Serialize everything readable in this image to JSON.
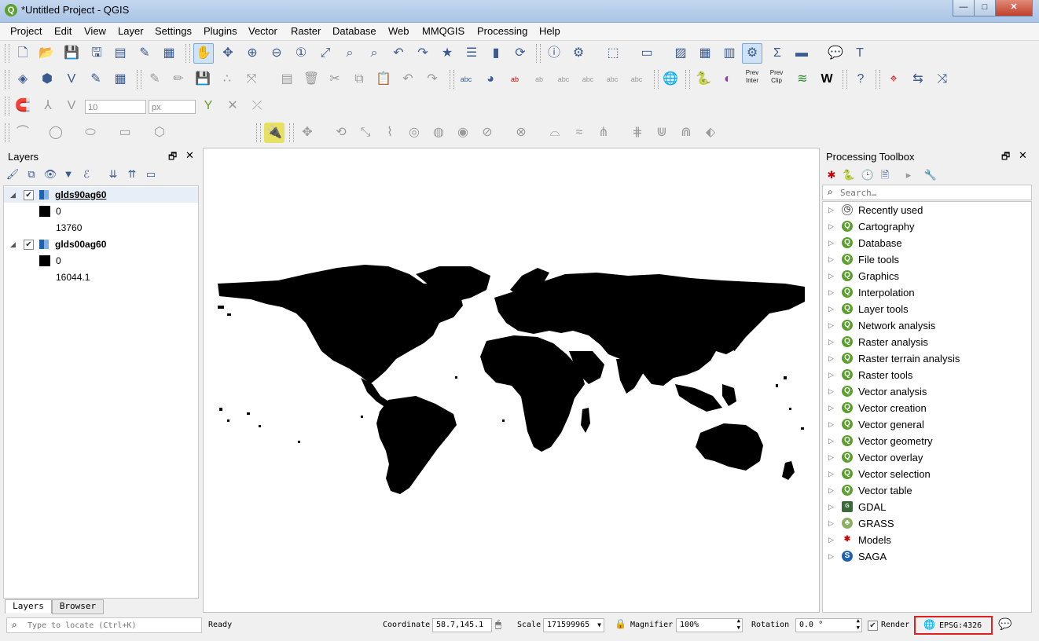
{
  "window": {
    "title": "*Untitled Project - QGIS",
    "min": "—",
    "max": "□",
    "close": "✕"
  },
  "menu": [
    "Project",
    "Edit",
    "View",
    "Layer",
    "Settings",
    "Plugins",
    "Vector",
    "Raster",
    "Database",
    "Web",
    "MMQGIS",
    "Processing",
    "Help"
  ],
  "layers_panel": {
    "title": "Layers",
    "layers": [
      {
        "name": "glds90ag60",
        "min": "0",
        "max": "13760",
        "checked": true
      },
      {
        "name": "glds00ag60",
        "min": "0",
        "max": "16044.1",
        "checked": true
      }
    ],
    "tabs": [
      "Layers",
      "Browser"
    ]
  },
  "digitize": {
    "size_value": "10",
    "unit": "px"
  },
  "toolbox": {
    "title": "Processing Toolbox",
    "search_placeholder": "Search…",
    "items": [
      {
        "label": "Recently used",
        "icon": "clock-icon"
      },
      {
        "label": "Cartography",
        "icon": "qgis-icon"
      },
      {
        "label": "Database",
        "icon": "qgis-icon"
      },
      {
        "label": "File tools",
        "icon": "qgis-icon"
      },
      {
        "label": "Graphics",
        "icon": "qgis-icon"
      },
      {
        "label": "Interpolation",
        "icon": "qgis-icon"
      },
      {
        "label": "Layer tools",
        "icon": "qgis-icon"
      },
      {
        "label": "Network analysis",
        "icon": "qgis-icon"
      },
      {
        "label": "Raster analysis",
        "icon": "qgis-icon"
      },
      {
        "label": "Raster terrain analysis",
        "icon": "qgis-icon"
      },
      {
        "label": "Raster tools",
        "icon": "qgis-icon"
      },
      {
        "label": "Vector analysis",
        "icon": "qgis-icon"
      },
      {
        "label": "Vector creation",
        "icon": "qgis-icon"
      },
      {
        "label": "Vector general",
        "icon": "qgis-icon"
      },
      {
        "label": "Vector geometry",
        "icon": "qgis-icon"
      },
      {
        "label": "Vector overlay",
        "icon": "qgis-icon"
      },
      {
        "label": "Vector selection",
        "icon": "qgis-icon"
      },
      {
        "label": "Vector table",
        "icon": "qgis-icon"
      },
      {
        "label": "GDAL",
        "icon": "gdal-icon"
      },
      {
        "label": "GRASS",
        "icon": "grass-icon"
      },
      {
        "label": "Models",
        "icon": "models-icon"
      },
      {
        "label": "SAGA",
        "icon": "saga-icon"
      }
    ]
  },
  "status": {
    "locate_placeholder": "Type to locate (Ctrl+K)",
    "message": "Ready",
    "coordinate_label": "Coordinate",
    "coordinate_value": "58.7,145.1",
    "scale_label": "Scale",
    "scale_value": "171599965",
    "magnifier_label": "Magnifier",
    "magnifier_value": "100%",
    "rotation_label": "Rotation",
    "rotation_value": "0.0 °",
    "render_label": "Render",
    "crs": "EPSG:4326"
  },
  "colors": {
    "crs_highlight": "#e02020",
    "qgis_green": "#5aa02c",
    "map_fill": "#000000"
  }
}
